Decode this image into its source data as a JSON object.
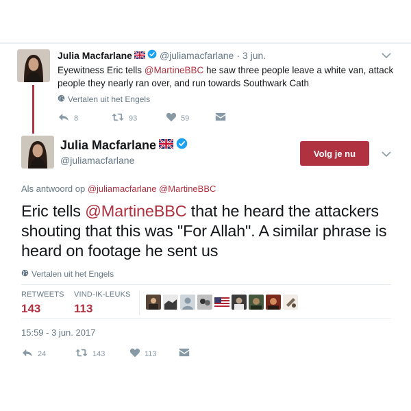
{
  "parent_tweet": {
    "name": "Julia Macfarlane",
    "handle": "@juliamacfarlane",
    "separator": "·",
    "time": "3 jun.",
    "text_prefix": "Eyewitness Eric tells ",
    "text_mention": "@MartineBBC",
    "text_suffix": " he saw three people leave a white van, attack people they nearly ran over, and run towards Southwark Cath",
    "translate_label": "Vertalen uit het Engels",
    "reply_count": "8",
    "retweet_count": "93",
    "like_count": "59"
  },
  "main_tweet": {
    "name": "Julia Macfarlane",
    "handle": "@juliamacfarlane",
    "follow_label": "Volg je nu",
    "reply_to_prefix": "Als antwoord op ",
    "reply_to_mention_1": "@juliamacfarlane",
    "reply_to_mention_2": "@MartineBBC",
    "text_prefix": "Eric tells ",
    "text_mention": "@MartineBBC",
    "text_suffix": " that he heard the attackers shouting that this was \"For Allah\". A similar phrase is heard on footage he sent us",
    "translate_label": "Vertalen uit het Engels",
    "retweets_label": "RETWEETS",
    "retweets_value": "143",
    "likes_label": "VIND-IK-LEUKS",
    "likes_value": "113",
    "timestamp": "15:59 - 3 jun. 2017",
    "reply_count": "24",
    "retweet_count": "143",
    "like_count": "113"
  },
  "colors": {
    "accent": "#b0313f",
    "verified": "#1da1f2",
    "muted": "#657786"
  },
  "icons": [
    "chevron-down-icon",
    "verified-badge-icon",
    "uk-flag-icon",
    "globe-icon",
    "reply-icon",
    "retweet-icon",
    "heart-icon",
    "message-icon"
  ]
}
